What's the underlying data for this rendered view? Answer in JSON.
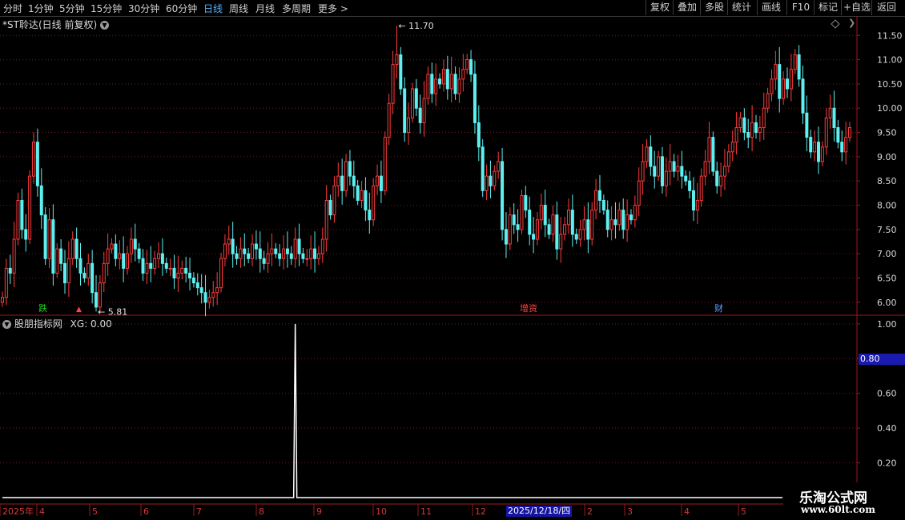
{
  "toolbar": {
    "periods": [
      "分时",
      "1分钟",
      "5分钟",
      "15分钟",
      "30分钟",
      "60分钟",
      "日线",
      "周线",
      "月线",
      "多周期",
      "更多 >"
    ],
    "active_period": "日线",
    "buttons": [
      "复权",
      "叠加",
      "多股",
      "统计",
      "画线",
      "F10",
      "标记",
      "+自选",
      "返回"
    ]
  },
  "stock": {
    "title": "*ST聆达(日线 前复权)",
    "high_label": "11.70",
    "low_label": "5.81"
  },
  "markers": [
    {
      "text": "跌",
      "color": "#22cc22"
    },
    {
      "text": "增资",
      "color": "#ff4444"
    },
    {
      "text": "财",
      "color": "#5aa0ff"
    }
  ],
  "indicator": {
    "title": "股朋指标网",
    "xg_label": "XG: 0.00",
    "cursor_value": "0.80"
  },
  "colors": {
    "up": "#ff3c3c",
    "down": "#5ef0f0",
    "frame": "#a01818",
    "grid": "#6e1a1a"
  },
  "chart_data": [
    {
      "type": "candlestick",
      "title": "*ST聆达(日线 前复权)",
      "y_ticks": [
        "11.50",
        "11.00",
        "10.50",
        "10.00",
        "9.50",
        "9.00",
        "8.50",
        "8.00",
        "7.50",
        "7.00",
        "6.50",
        "6.00"
      ],
      "ylim": [
        5.75,
        11.9
      ],
      "x_labels": [
        "2025年",
        "4",
        "5",
        "6",
        "7",
        "8",
        "9",
        "10",
        "11",
        "12",
        "2025/12/18/四",
        "2",
        "3",
        "4",
        "5"
      ],
      "period_high": 11.7,
      "period_low": 5.81,
      "closes": [
        6.1,
        6.7,
        6.6,
        7.3,
        8.1,
        7.5,
        7.3,
        8.6,
        9.3,
        8.4,
        7.8,
        6.9,
        7.7,
        6.6,
        7.1,
        6.8,
        6.4,
        6.9,
        7.3,
        6.9,
        6.6,
        6.5,
        6.8,
        6.2,
        5.9,
        6.4,
        6.8,
        7.1,
        7.2,
        6.9,
        7.0,
        6.7,
        7.0,
        7.3,
        7.1,
        6.9,
        6.6,
        6.8,
        6.7,
        6.9,
        7.0,
        6.8,
        6.7,
        6.7,
        6.5,
        6.6,
        6.7,
        6.6,
        6.5,
        6.4,
        6.3,
        6.2,
        6.0,
        6.1,
        6.2,
        6.3,
        6.9,
        7.2,
        7.3,
        7.0,
        6.9,
        7.1,
        7.0,
        6.9,
        7.2,
        7.1,
        6.9,
        6.8,
        7.0,
        7.1,
        7.0,
        6.9,
        7.1,
        7.0,
        6.9,
        7.3,
        7.0,
        6.9,
        6.9,
        7.1,
        6.9,
        7.0,
        7.3,
        8.1,
        7.8,
        8.4,
        8.6,
        8.3,
        8.9,
        8.6,
        8.4,
        8.1,
        8.3,
        7.9,
        7.7,
        8.4,
        8.6,
        8.3,
        9.4,
        10.1,
        10.9,
        11.1,
        10.4,
        9.5,
        9.8,
        10.4,
        10.0,
        9.7,
        10.2,
        10.7,
        10.3,
        10.6,
        10.5,
        10.8,
        10.4,
        10.7,
        10.3,
        10.6,
        10.8,
        11.0,
        10.7,
        9.7,
        9.2,
        8.3,
        8.6,
        8.4,
        8.7,
        8.9,
        7.5,
        7.2,
        7.8,
        7.6,
        7.5,
        8.2,
        7.9,
        7.4,
        7.3,
        7.7,
        8.0,
        7.6,
        7.4,
        7.8,
        7.1,
        7.4,
        7.6,
        7.9,
        7.4,
        7.3,
        7.5,
        7.7,
        7.3,
        7.9,
        8.3,
        8.1,
        7.9,
        7.5,
        7.7,
        7.6,
        7.9,
        7.5,
        7.8,
        7.7,
        8.0,
        8.5,
        8.9,
        9.2,
        8.8,
        8.6,
        9.0,
        8.4,
        8.7,
        8.9,
        8.7,
        8.8,
        8.6,
        8.5,
        8.3,
        7.9,
        8.1,
        8.6,
        8.9,
        9.4,
        8.7,
        8.4,
        8.6,
        8.8,
        9.1,
        9.3,
        9.6,
        9.8,
        9.5,
        9.4,
        9.7,
        9.5,
        9.6,
        10.0,
        10.3,
        10.6,
        10.9,
        10.2,
        10.6,
        10.4,
        10.8,
        11.1,
        10.6,
        9.9,
        9.4,
        9.1,
        9.3,
        8.9,
        9.2,
        9.8,
        10.0,
        9.6,
        9.3,
        9.1,
        9.4,
        9.6
      ]
    },
    {
      "type": "line",
      "title": "股朋指标网",
      "y_ticks": [
        "1.00",
        "0.80",
        "0.60",
        "0.40",
        "0.20"
      ],
      "ylim": [
        0,
        1.05
      ],
      "spike_index": 75,
      "spike_value": 1.0,
      "baseline": 0.0
    }
  ]
}
